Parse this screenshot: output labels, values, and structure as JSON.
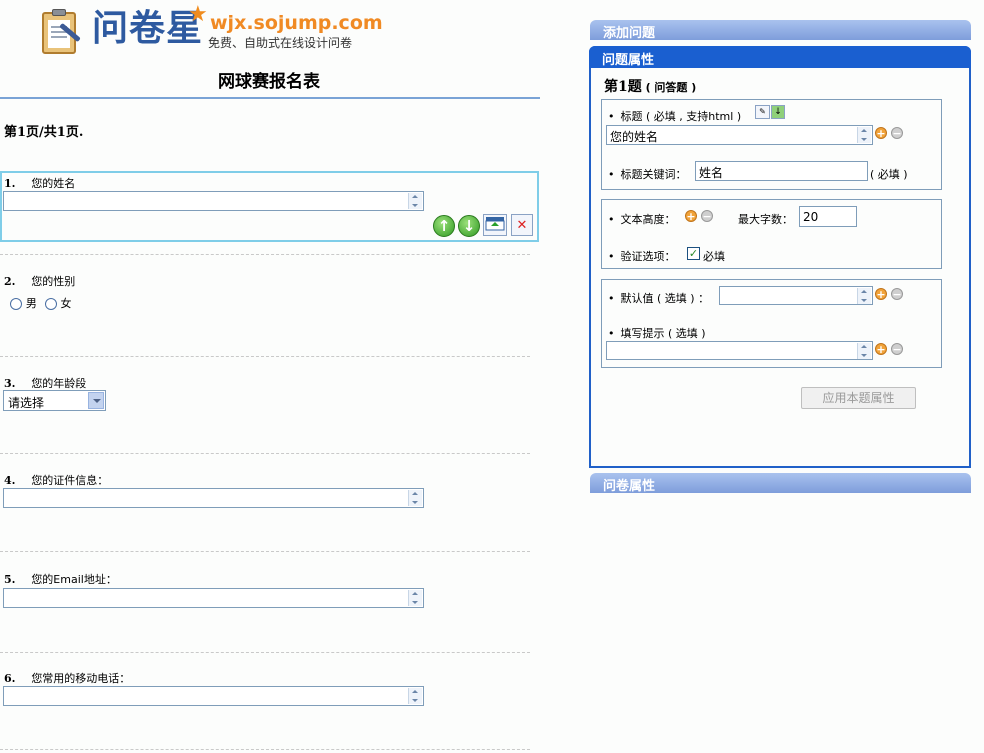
{
  "logo": {
    "name": "问卷星",
    "url": "wjx.sojump.com",
    "slogan": "免费、自助式在线设计问卷"
  },
  "survey": {
    "title": "网球赛报名表",
    "page_indicator": "第1页/共1页."
  },
  "questions": [
    {
      "num": "1.",
      "label": "您的姓名"
    },
    {
      "num": "2.",
      "label": "您的性别",
      "options": [
        "男",
        "女"
      ]
    },
    {
      "num": "3.",
      "label": "您的年龄段",
      "select_value": "请选择"
    },
    {
      "num": "4.",
      "label": "您的证件信息："
    },
    {
      "num": "5.",
      "label": "您的Email地址："
    },
    {
      "num": "6.",
      "label": "您常用的移动电话："
    }
  ],
  "toolbar_icons": [
    "move-up-icon",
    "move-down-icon",
    "insert-icon",
    "delete-icon"
  ],
  "panel": {
    "add_tab": "添加问题",
    "props_tab": "问题属性",
    "survey_tab": "问卷属性",
    "question_heading": "第1题",
    "question_type": "( 问答题 )",
    "title_label": "标题 ( 必填 , 支持html )",
    "title_value": "您的姓名",
    "keyword_label": "标题关键词：",
    "keyword_value": "姓名",
    "keyword_required": "( 必填 )",
    "text_height_label": "文本高度：",
    "max_chars_label": "最大字数：",
    "max_chars_value": "20",
    "validation_label": "验证选项：",
    "required_label": "必填",
    "default_label": "默认值 ( 选填 ) ：",
    "hint_label": "填写提示 ( 选填 )",
    "apply_button": "应用本题属性"
  },
  "colors": {
    "panel_active": "#1a5fd0",
    "panel_tab": "#8eaae2",
    "logo_blue": "#2e5aa0",
    "logo_orange": "#f08a24"
  }
}
